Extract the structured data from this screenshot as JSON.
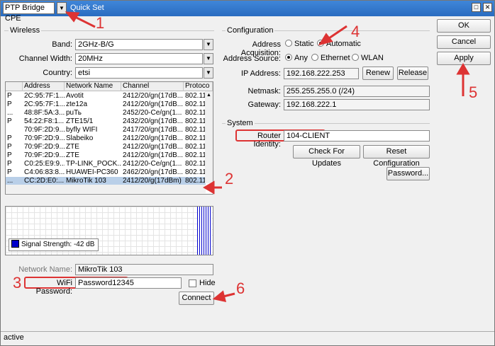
{
  "window": {
    "profile": "PTP Bridge CPE",
    "title": "Quick Set",
    "controls": [
      "restore-icon",
      "close-icon"
    ]
  },
  "wireless": {
    "title": "Wireless",
    "band_label": "Band:",
    "band_value": "2GHz-B/G",
    "channel_width_label": "Channel Width:",
    "channel_width_value": "20MHz",
    "country_label": "Country:",
    "country_value": "etsi",
    "table": {
      "columns": [
        "",
        "Address",
        "Network Name",
        "Channel",
        "Protoco"
      ],
      "rows": [
        {
          "flag": "P",
          "address": "2C:95:7F:1...",
          "network": "Avotit",
          "channel": "2412/20/gn(17dB...",
          "protocol": "802.11"
        },
        {
          "flag": "P",
          "address": "2C:95:7F:1...",
          "network": "zte12a",
          "channel": "2412/20/gn(17dB...",
          "protocol": "802.11"
        },
        {
          "flag": "...",
          "address": "48:8F:5A:3...",
          "network": "puТь",
          "channel": "2452/20-Ce/gn(1...",
          "protocol": "802.11"
        },
        {
          "flag": "P",
          "address": "54:22:F8:1...",
          "network": "ZTE15/1",
          "channel": "2432/20/gn(17dB...",
          "protocol": "802.11"
        },
        {
          "flag": "",
          "address": "70:9F:2D:9...",
          "network": "byfly WIFI",
          "channel": "2417/20/gn(17dB...",
          "protocol": "802.11"
        },
        {
          "flag": "P",
          "address": "70:9F:2D:9...",
          "network": "Slabeiko",
          "channel": "2412/20/gn(17dB...",
          "protocol": "802.11"
        },
        {
          "flag": "P",
          "address": "70:9F:2D:9...",
          "network": "ZTE",
          "channel": "2412/20/gn(17dB...",
          "protocol": "802.11"
        },
        {
          "flag": "P",
          "address": "70:9F:2D:9...",
          "network": "ZTE",
          "channel": "2412/20/gn(17dB...",
          "protocol": "802.11"
        },
        {
          "flag": "P",
          "address": "C0:25:E9:9...",
          "network": "TP-LINK_POCK...",
          "channel": "2412/20-Ce/gn(1...",
          "protocol": "802.11"
        },
        {
          "flag": "P",
          "address": "C4:06:83:8...",
          "network": "HUAWEI-PC360",
          "channel": "2462/20/gn(17dB...",
          "protocol": "802.11"
        },
        {
          "flag": "...",
          "address": "CC:2D:E0:...",
          "network": "MikroTik 103",
          "channel": "2412/20/g(17dBm)",
          "protocol": "802.11"
        }
      ],
      "selected_row": 10
    },
    "signal_label": "Signal Strength:",
    "signal_value": "-42 dB",
    "network_name_label": "Network Name:",
    "network_name_value": "MikroTik 103",
    "password_label": "WiFi Password:",
    "password_value": "Password12345",
    "hide_label": "Hide",
    "connect_label": "Connect"
  },
  "configuration": {
    "title": "Configuration",
    "acq_label": "Address Acquisition:",
    "acq_static": "Static",
    "acq_automatic": "Automatic",
    "source_label": "Address Source:",
    "source_any": "Any",
    "source_ethernet": "Ethernet",
    "source_wlan": "WLAN",
    "ip_label": "IP Address:",
    "ip_value": "192.168.222.253",
    "renew_label": "Renew",
    "release_label": "Release",
    "netmask_label": "Netmask:",
    "netmask_value": "255.255.255.0 (/24)",
    "gateway_label": "Gateway:",
    "gateway_value": "192.168.222.1"
  },
  "system": {
    "title": "System",
    "identity_label": "Router Identity:",
    "identity_value": "104-CLIENT",
    "check_updates_label": "Check For Updates",
    "reset_label": "Reset Configuration",
    "password_label": "Password..."
  },
  "actions": {
    "ok_label": "OK",
    "cancel_label": "Cancel",
    "apply_label": "Apply"
  },
  "status": {
    "text": "active"
  },
  "annotations": {
    "step1": "1",
    "step2": "2",
    "step3": "3",
    "step4": "4",
    "step5": "5",
    "step6": "6",
    "color": "#d33333"
  }
}
